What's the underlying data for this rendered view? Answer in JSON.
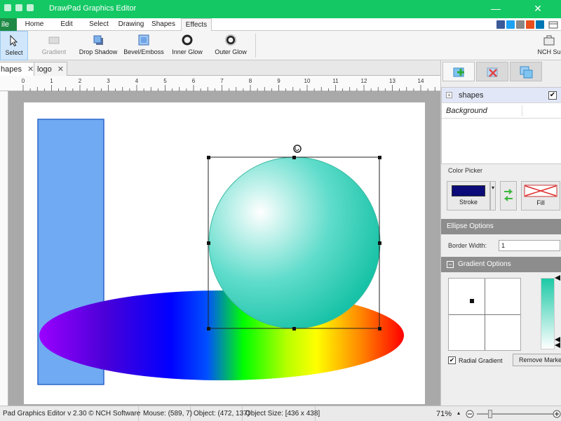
{
  "window": {
    "title": "DrawPad Graphics Editor",
    "minimize": "—",
    "close": "✕"
  },
  "menu": {
    "file": "ile",
    "items": [
      "Home",
      "Edit",
      "Select",
      "Drawing",
      "Shapes",
      "Effects"
    ],
    "active": "Effects"
  },
  "ribbon": {
    "select": "Select",
    "gradient": "Gradient",
    "drop_shadow": "Drop Shadow",
    "bevel_emboss": "Bevel/Emboss",
    "inner_glow": "Inner Glow",
    "outer_glow": "Outer Glow",
    "nch_suite": "NCH Su"
  },
  "doc_tabs": [
    {
      "label": "hapes",
      "close": "✕"
    },
    {
      "label": "logo",
      "close": "✕"
    }
  ],
  "ruler": {
    "labels": [
      "0",
      "1",
      "2",
      "3",
      "4",
      "5",
      "6",
      "7",
      "8",
      "9",
      "10",
      "11",
      "12",
      "13",
      "14"
    ]
  },
  "layers": {
    "shapes": "shapes",
    "background": "Background"
  },
  "color_picker": {
    "label": "Color Picker",
    "stroke": "Stroke",
    "fill": "Fill",
    "stroke_color": "#0a0a78"
  },
  "ellipse_options": {
    "header": "Ellipse Options",
    "border_width_label": "Border Width:",
    "border_width_value": "1"
  },
  "gradient_options": {
    "header": "Gradient Options",
    "radial_label": "Radial Gradient",
    "remove_marker": "Remove Marker",
    "color_start": "#1cc9a6",
    "color_end": "#ffffff"
  },
  "status": {
    "app": "Pad Graphics Editor v 2.30 © NCH Software",
    "mouse": "Mouse: (589, 7)",
    "object": "Object: (472, 137)",
    "object_size": "Object Size: [436 x 438]",
    "zoom": "71%"
  },
  "colors": {
    "title_green": "#14c864",
    "rect_fill": "#6faaf2",
    "rect_stroke": "#2b66c9",
    "sphere_highlight": "#ffffff",
    "sphere_base": "#17c2a6"
  },
  "icons": {
    "select": "cursor-arrow-icon",
    "copyright": "copyright-icon",
    "zoom_out": "zoom-out-icon",
    "zoom_in": "zoom-in-icon"
  }
}
